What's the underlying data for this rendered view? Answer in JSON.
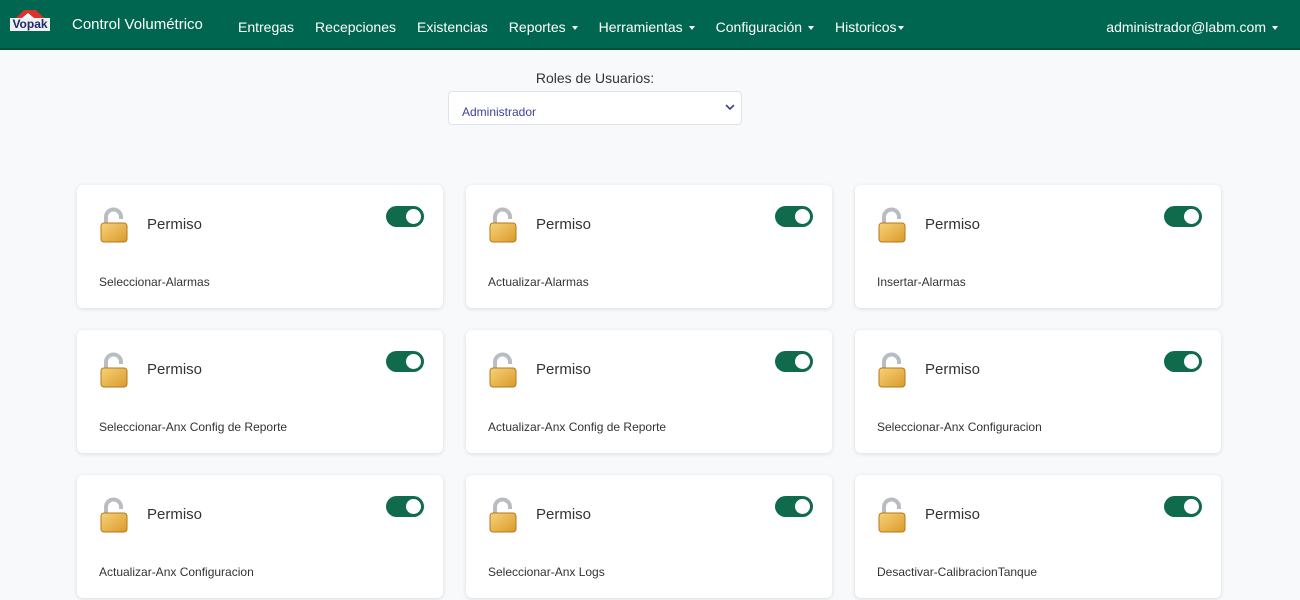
{
  "navbar": {
    "logo_text": "Vopak",
    "brand": "Control Volumétrico",
    "items": [
      {
        "label": "Entregas",
        "dropdown": false
      },
      {
        "label": "Recepciones",
        "dropdown": false
      },
      {
        "label": "Existencias",
        "dropdown": false
      },
      {
        "label": "Reportes",
        "dropdown": true
      },
      {
        "label": "Herramientas",
        "dropdown": true
      },
      {
        "label": "Configuración",
        "dropdown": true
      },
      {
        "label": "Historicos",
        "dropdown": true
      }
    ],
    "user": "administrador@labm.com"
  },
  "roles": {
    "label": "Roles de Usuarios:",
    "selected": "Administrador"
  },
  "cards": [
    {
      "title": "Permiso",
      "permission": "Seleccionar-Alarmas",
      "enabled": true
    },
    {
      "title": "Permiso",
      "permission": "Actualizar-Alarmas",
      "enabled": true
    },
    {
      "title": "Permiso",
      "permission": "Insertar-Alarmas",
      "enabled": true
    },
    {
      "title": "Permiso",
      "permission": "Seleccionar-Anx Config de Reporte",
      "enabled": true
    },
    {
      "title": "Permiso",
      "permission": "Actualizar-Anx Config de Reporte",
      "enabled": true
    },
    {
      "title": "Permiso",
      "permission": "Seleccionar-Anx Configuracion",
      "enabled": true
    },
    {
      "title": "Permiso",
      "permission": "Actualizar-Anx Configuracion",
      "enabled": true
    },
    {
      "title": "Permiso",
      "permission": "Seleccionar-Anx Logs",
      "enabled": true
    },
    {
      "title": "Permiso",
      "permission": "Desactivar-CalibracionTanque",
      "enabled": true
    }
  ],
  "colors": {
    "navbar": "#00664f",
    "toggle_on": "#0f6b4c",
    "logo_red": "#d9342b",
    "logo_blue": "#1d2a6b"
  },
  "icons": {
    "card_icon": "unlocked-padlock-icon",
    "select_icon": "chevron-down-icon"
  }
}
